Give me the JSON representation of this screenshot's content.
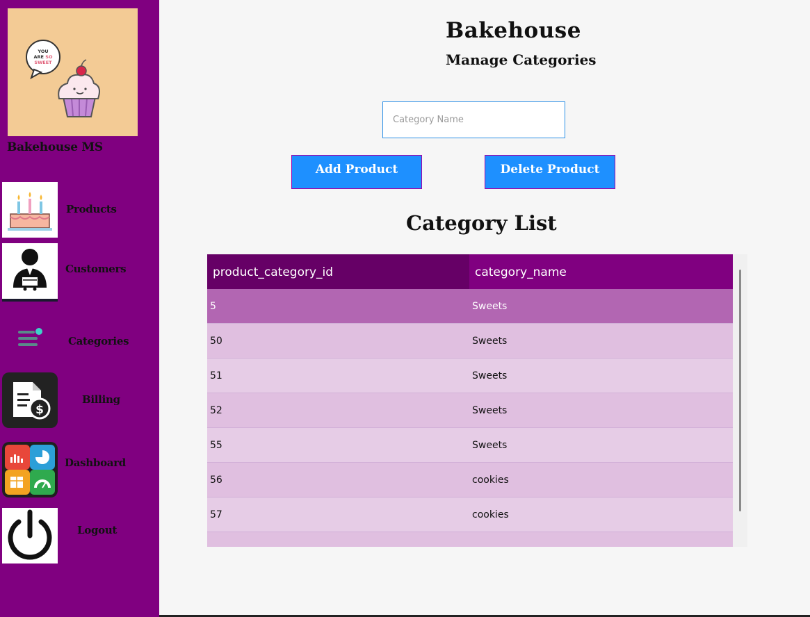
{
  "sidebar": {
    "brand": "Bakehouse MS",
    "logo_bubble_text": "YOU ARE SO SWEET",
    "items": [
      {
        "label": "Products",
        "icon": "cake-icon"
      },
      {
        "label": "Customers",
        "icon": "customer-icon"
      },
      {
        "label": "Categories",
        "icon": "categories-icon"
      },
      {
        "label": "Billing",
        "icon": "bill-icon"
      },
      {
        "label": "Dashboard",
        "icon": "dashboard-icon"
      },
      {
        "label": "Logout",
        "icon": "power-icon"
      }
    ]
  },
  "header": {
    "title": "Bakehouse",
    "subtitle": "Manage Categories"
  },
  "form": {
    "category_placeholder": "Category Name",
    "category_value": "",
    "add_label": "Add Product",
    "delete_label": "Delete Product"
  },
  "list": {
    "title": "Category List",
    "columns": [
      "product_category_id",
      "category_name"
    ],
    "rows": [
      {
        "id": "5",
        "name": "Sweets",
        "selected": true
      },
      {
        "id": "50",
        "name": "Sweets"
      },
      {
        "id": "51",
        "name": "Sweets"
      },
      {
        "id": "52",
        "name": "Sweets"
      },
      {
        "id": "55",
        "name": "Sweets"
      },
      {
        "id": "56",
        "name": "cookies"
      },
      {
        "id": "57",
        "name": "cookies"
      },
      {
        "id": "",
        "name": ""
      }
    ]
  },
  "colors": {
    "sidebar": "#800080",
    "button": "#1e90ff",
    "header_row": "#800080",
    "header_selected_col": "#660066",
    "row_selected": "#b266b2",
    "row_even": "#e0bfe0",
    "row_odd": "#e6cce6"
  }
}
